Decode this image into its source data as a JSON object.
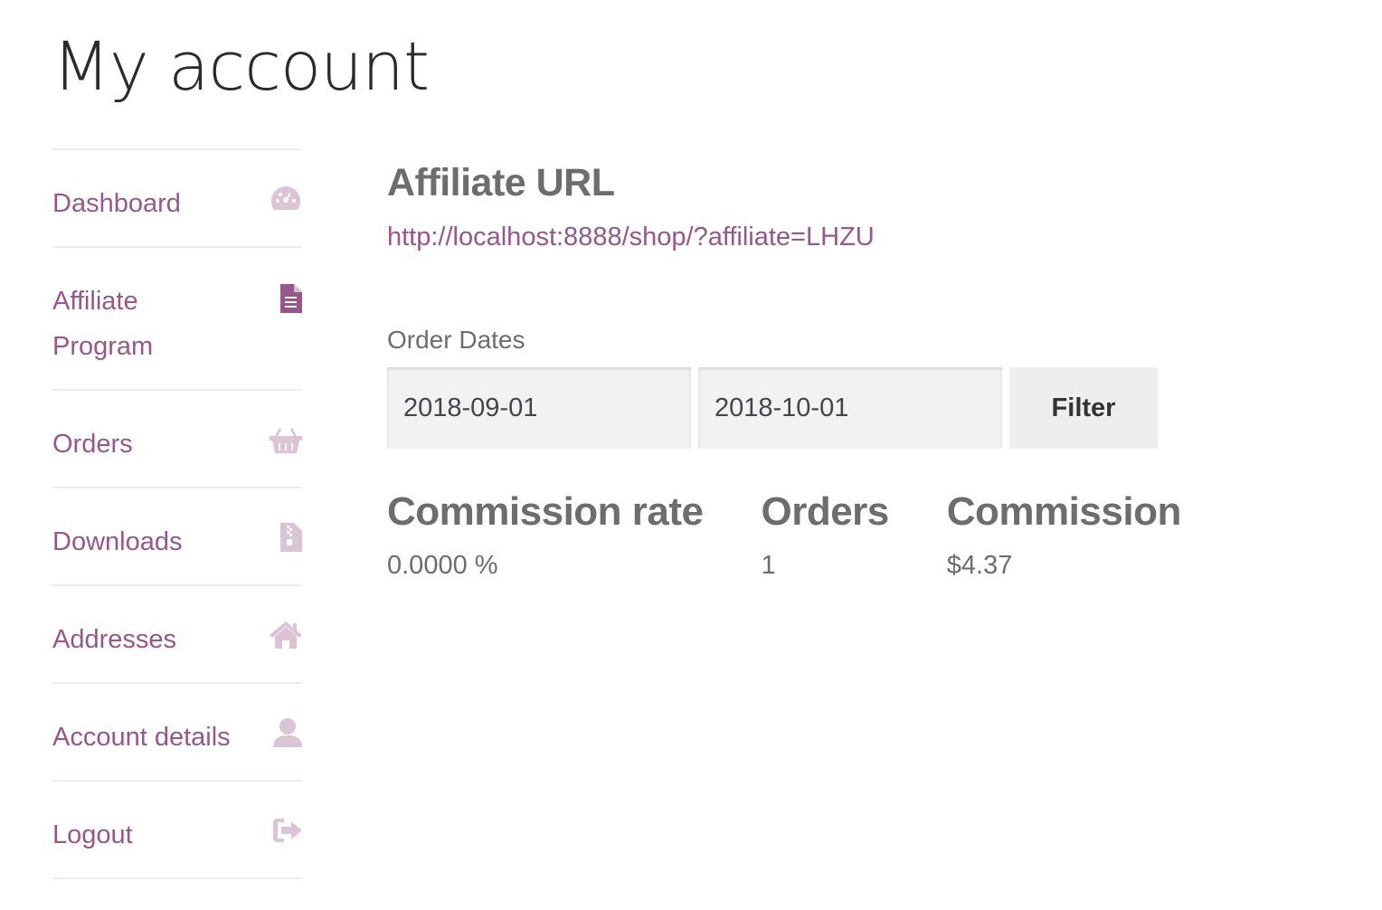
{
  "page": {
    "title": "My account"
  },
  "nav": {
    "items": [
      {
        "label": "Dashboard",
        "icon": "dashboard-icon"
      },
      {
        "label": "Affiliate Program",
        "icon": "file-icon"
      },
      {
        "label": "Orders",
        "icon": "basket-icon"
      },
      {
        "label": "Downloads",
        "icon": "file-archive-icon"
      },
      {
        "label": "Addresses",
        "icon": "home-icon"
      },
      {
        "label": "Account details",
        "icon": "user-icon"
      },
      {
        "label": "Logout",
        "icon": "sign-out-icon"
      }
    ],
    "active_index": 1
  },
  "affiliate": {
    "heading": "Affiliate URL",
    "url": "http://localhost:8888/shop/?affiliate=LHZU"
  },
  "filter": {
    "label": "Order Dates",
    "start_date": "2018-09-01",
    "end_date": "2018-10-01",
    "button_label": "Filter"
  },
  "stats": {
    "headers": [
      "Commission rate",
      "Orders",
      "Commission"
    ],
    "values": [
      "0.0000 %",
      "1",
      "$4.37"
    ]
  },
  "colors": {
    "accent": "#96588a",
    "text": "#6d6d6d",
    "title": "#2b2b2b"
  }
}
